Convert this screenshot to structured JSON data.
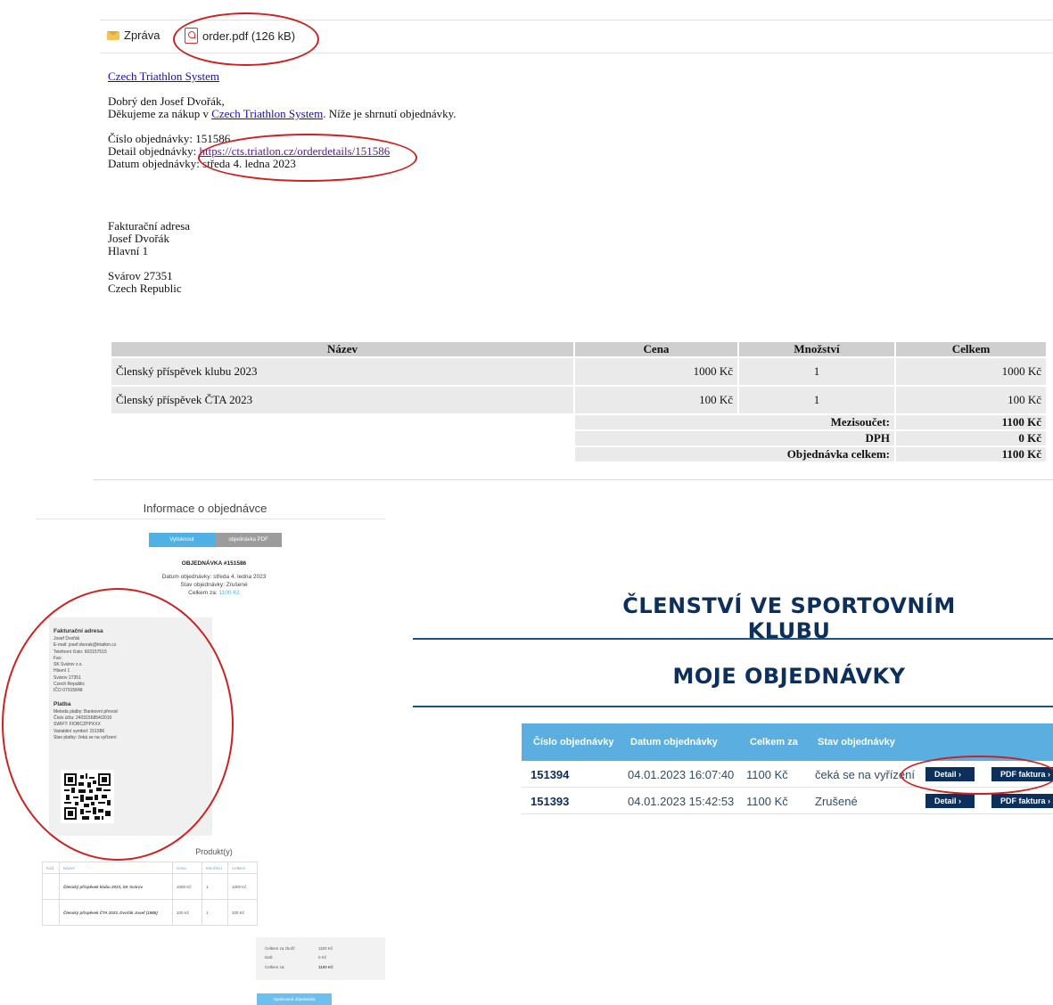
{
  "email": {
    "tab_message": "Zpráva",
    "tab_attachment": "order.pdf (126 kB)",
    "brand_link": "Czech Triathlon System",
    "greeting": "Dobrý den Josef Dvořák,",
    "thanks_pre": "Děkujeme za nákup v ",
    "thanks_link": "Czech Triathlon System",
    "thanks_post": ". Níže je shrnutí objednávky.",
    "order_no_label": "Číslo objednávky: ",
    "order_no": "151586",
    "detail_label": "Detail objednávky: ",
    "detail_url": "https://cts.triatlon.cz/orderdetails/151586",
    "date_label": "Datum objednávky: ",
    "date": "středa 4. ledna 2023",
    "billing_title": "Fakturační adresa",
    "billing_name": "Josef Dvořák",
    "billing_street": "Hlavní 1",
    "billing_city": "Svárov 27351",
    "billing_country": "Czech Republic",
    "table": {
      "headers": [
        "Název",
        "Cena",
        "Množství",
        "Celkem"
      ],
      "rows": [
        [
          "Členský příspěvek klubu 2023",
          "1000 Kč",
          "1",
          "1000 Kč"
        ],
        [
          "Členský příspěvek ČTA 2023",
          "100 Kč",
          "1",
          "100 Kč"
        ]
      ],
      "subtotal_label": "Mezisoučet:",
      "subtotal": "1100 Kč",
      "tax_label": "DPH",
      "tax": "0 Kč",
      "total_label": "Objednávka celkem:",
      "total": "1100 Kč"
    }
  },
  "info": {
    "title": "Informace o objednávce",
    "print_button": "Vytisknout",
    "pdf_button": "objednávka PDF",
    "order_heading": "OBJEDNÁVKA #151586",
    "date_line": "Datum objednávky: středa 4. ledna 2023",
    "status_line": "Stav objednávky: Zrušené",
    "total_label": "Celkem za: ",
    "total_value": "1100 Kč",
    "billing_title": "Fakturační adresa",
    "billing_lines": [
      "Josef Dvořák",
      "E-mail: josef.dvorak@triatlon.cz",
      "Telefonní číslo: 603157515",
      "Fax:",
      "SK Svárov z.s.",
      "Hlavní 1",
      "Svárov 27351",
      "Czech Republic",
      "IČO 07915848"
    ],
    "payment_title": "Platba",
    "payment_lines": [
      "Metoda platby: Bankovní převod",
      "Číslo účtu: 2403156854/2010",
      "SWIFT: FIOBCZPPXXX",
      "Variabilní symbol: 151586",
      "Stav platby: čeká se na vyřízení"
    ],
    "products_title": "Produkt(y)",
    "product_headers": [
      "Kód",
      "Název",
      "Cena",
      "Množství",
      "Celkem"
    ],
    "products": [
      [
        "",
        "Členský příspěvek klubu 2023, SK Svárov",
        "1000 Kč",
        "1",
        "1000 Kč"
      ],
      [
        "",
        "Členský příspěvek ČTA 2023, Dvořák Josef (1985)",
        "100 Kč",
        "1",
        "100 Kč"
      ]
    ],
    "totals": [
      [
        "Celkem za zboží:",
        "1100 Kč"
      ],
      [
        "Daň:",
        "0 Kč"
      ],
      [
        "Celkem za:",
        "1100 Kč"
      ]
    ],
    "repeat_button": "Opakovaná objednávka"
  },
  "orders": {
    "heading1": "ČLENSTVÍ VE SPORTOVNÍM KLUBU",
    "heading2": "MOJE OBJEDNÁVKY",
    "columns": [
      "Číslo objednávky",
      "Datum objednávky",
      "Celkem za",
      "Stav objednávky"
    ],
    "rows": [
      {
        "id": "151394",
        "date": "04.01.2023 16:07:40",
        "total": "1100 Kč",
        "status": "čeká se na vyřízení",
        "detail": "Detail",
        "pdf": "PDF faktura"
      },
      {
        "id": "151393",
        "date": "04.01.2023 15:42:53",
        "total": "1100 Kč",
        "status": "Zrušené",
        "detail": "Detail",
        "pdf": "PDF faktura"
      }
    ]
  },
  "colors": {
    "annotation": "#cc2222",
    "navy": "#0c2f5b",
    "header_blue": "#5aaee0"
  }
}
